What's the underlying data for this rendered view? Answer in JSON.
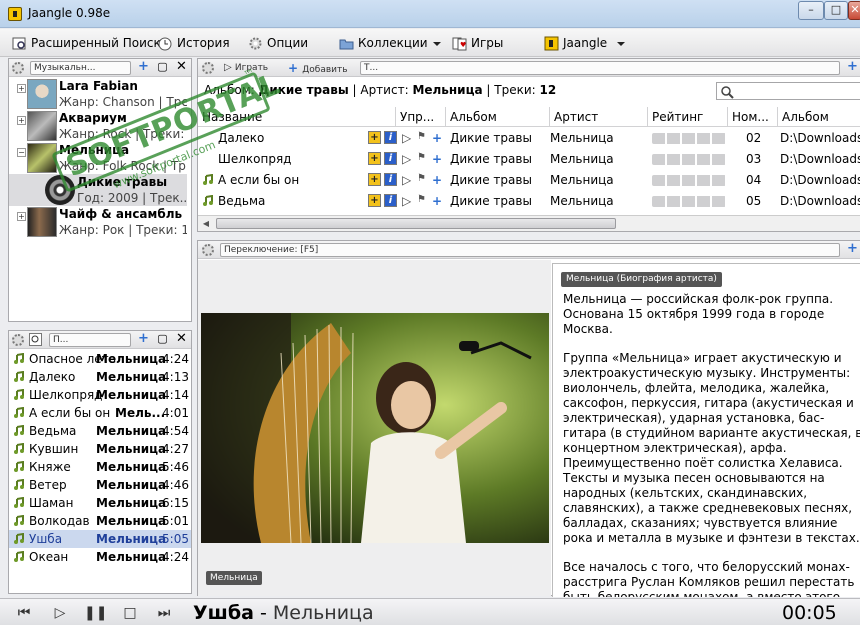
{
  "window": {
    "title": "Jaangle 0.98e",
    "min": "–",
    "max": "□",
    "close": "✕"
  },
  "menu": {
    "items": [
      {
        "label": "Расширенный Поиск",
        "icon": "search-icon"
      },
      {
        "label": "История",
        "icon": "history-icon"
      },
      {
        "label": "Опции",
        "icon": "gear-icon"
      },
      {
        "label": "Коллекции",
        "icon": "folder-icon"
      },
      {
        "label": "Игры",
        "icon": "cards-icon"
      },
      {
        "label": "Jaangle",
        "icon": "jaangle-icon"
      }
    ]
  },
  "left_top": {
    "field": "Музыкальн...",
    "artists": [
      {
        "name": "Lara Fabian",
        "sub": "Жанр: Chanson | Тре..."
      },
      {
        "name": "Аквариум",
        "sub": "Жанр: Rock | Треки:"
      },
      {
        "name": "Мельница",
        "sub": "Жанр: Folk Rock | Тр..."
      },
      {
        "name": "Дикие травы",
        "sub": "Год: 2009 | Трек..."
      },
      {
        "name": "Чайф & ансамбль \"...",
        "sub": "Жанр: Рок | Треки: 14"
      }
    ]
  },
  "left_bottom": {
    "field": "П...",
    "tracks": [
      {
        "t": "Опасное лето",
        "a": "Мельница",
        "d": "4:24"
      },
      {
        "t": "Далеко",
        "a": "Мельница",
        "d": "4:13"
      },
      {
        "t": "Шелкопряд",
        "a": "Мельница",
        "d": "4:14"
      },
      {
        "t": "А если бы он",
        "a": "Мель...",
        "d": "4:01"
      },
      {
        "t": "Ведьма",
        "a": "Мельница",
        "d": "4:54"
      },
      {
        "t": "Кувшин",
        "a": "Мельница",
        "d": "4:27"
      },
      {
        "t": "Княже",
        "a": "Мельница",
        "d": "5:46"
      },
      {
        "t": "Ветер",
        "a": "Мельница",
        "d": "4:46"
      },
      {
        "t": "Шаман",
        "a": "Мельница",
        "d": "6:15"
      },
      {
        "t": "Волкодав",
        "a": "Мельница",
        "d": "5:01"
      },
      {
        "t": "Ушба",
        "a": "Мельница",
        "d": "5:05"
      },
      {
        "t": "Океан",
        "a": "Мельница",
        "d": "4:24"
      }
    ]
  },
  "center_top": {
    "play_label": "Играть",
    "add_label": "Добавить",
    "field": "Т...",
    "summary": {
      "album_label": "Альбом:",
      "album": "Дикие травы",
      "artist_label": "Артист:",
      "artist": "Мельница",
      "tracks_label": "Треки:",
      "tracks": "12"
    },
    "search_placeholder": "",
    "columns": [
      "Название",
      "Упр...",
      "Альбом",
      "Артист",
      "Рейтинг",
      "Ном...",
      "Альбом"
    ],
    "rows": [
      {
        "t": "Далеко",
        "album": "Дикие травы",
        "artist": "Мельница",
        "num": "02",
        "path": "D:\\Downloads\\"
      },
      {
        "t": "Шелкопряд",
        "album": "Дикие травы",
        "artist": "Мельница",
        "num": "03",
        "path": "D:\\Downloads\\"
      },
      {
        "t": "А если бы он",
        "album": "Дикие травы",
        "artist": "Мельница",
        "num": "04",
        "path": "D:\\Downloads\\"
      },
      {
        "t": "Ведьма",
        "album": "Дикие травы",
        "artist": "Мельница",
        "num": "05",
        "path": "D:\\Downloads\\"
      }
    ]
  },
  "center_bottom": {
    "field": "Переключение: [F5]",
    "photo_caption": "Мельница",
    "bio_title": "Мельница (Биография артиста)",
    "bio": [
      "Мельница — российская фолк-рок группа. Основана 15 октября 1999 года в городе Москва.",
      "Группа «Мельница» играет акустическую и электроакустическую музыку. Инструменты: виолончель, флейта, мелодика, жалейка, саксофон, перкуссия, гитара (акустическая и электрическая), ударная установка, бас-гитара (в студийном варианте акустическая, в концертном электрическая), арфа. Преимущественно поёт солистка Хелависа. Тексты и музыка песен основываются на народных (кельтских, скандинавских, славянских), а также средневековых песнях, балладах, сказаниях; чувствуется влияние рока и металла в музыке и фэнтези в текстах.",
      "Все началось с того, что белорусский монах-расстрига Руслан Комляков решил перестать быть белорусским монахом, а вместо этого решил стать русским музыкантом."
    ]
  },
  "watermark": {
    "text": "SOFTPORTAL",
    "url": "www.softportal.com",
    "tm": "™"
  },
  "player": {
    "title": "Ушба",
    "sep": " - ",
    "artist": "Мельница",
    "time": "00:05"
  }
}
